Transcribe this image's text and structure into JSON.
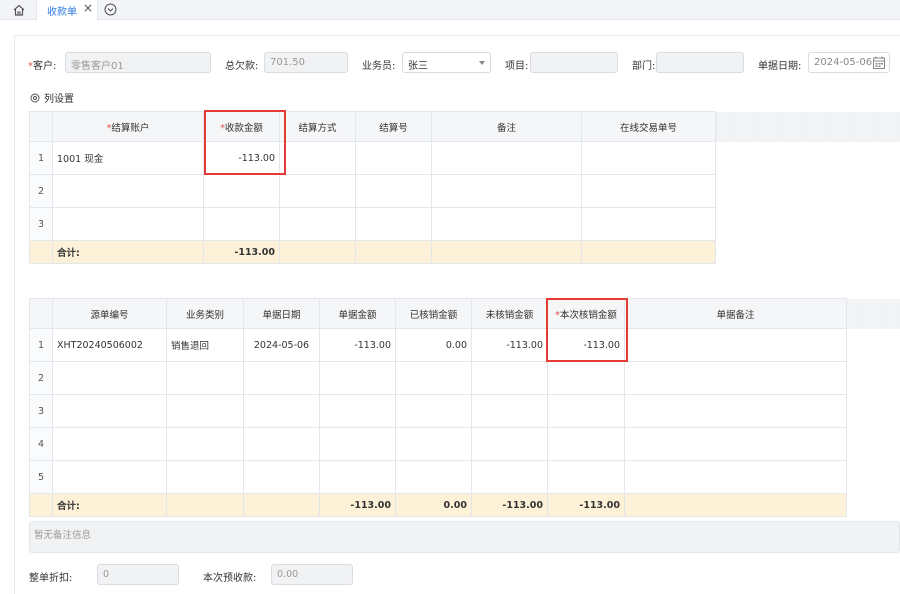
{
  "tabs": {
    "active_label": "收款单"
  },
  "form": {
    "customer": {
      "label": "客户:",
      "value": "零售客户01"
    },
    "total_due": {
      "label": "总欠款:",
      "value": "701.50"
    },
    "salesperson": {
      "label": "业务员:",
      "value": "张三"
    },
    "project": {
      "label": "项目:",
      "value": ""
    },
    "department": {
      "label": "部门:",
      "value": ""
    },
    "doc_date": {
      "label": "单据日期:",
      "value": "2024-05-06"
    }
  },
  "column_settings": "列设置",
  "receipt_grid": {
    "headers": [
      "结算账户",
      "收款金额",
      "结算方式",
      "结算号",
      "备注",
      "在线交易单号"
    ],
    "rows": [
      {
        "no": "1",
        "account": "1001 现金",
        "amount": "-113.00",
        "method": "",
        "settle_no": "",
        "remark": "",
        "online_no": ""
      },
      {
        "no": "2",
        "account": "",
        "amount": "",
        "method": "",
        "settle_no": "",
        "remark": "",
        "online_no": ""
      },
      {
        "no": "3",
        "account": "",
        "amount": "",
        "method": "",
        "settle_no": "",
        "remark": "",
        "online_no": ""
      }
    ],
    "total_label": "合计:",
    "total_amount": "-113.00"
  },
  "source_grid": {
    "headers": [
      "源单编号",
      "业务类别",
      "单据日期",
      "单据金额",
      "已核销金额",
      "未核销金额",
      "本次核销金额",
      "单据备注"
    ],
    "rows": [
      {
        "no": "1",
        "src_no": "XHT20240506002",
        "biz_type": "销售退回",
        "date": "2024-05-06",
        "amount": "-113.00",
        "written_off": "0.00",
        "unwritten": "-113.00",
        "this_writeoff": "-113.00",
        "remark": ""
      },
      {
        "no": "2",
        "src_no": "",
        "biz_type": "",
        "date": "",
        "amount": "",
        "written_off": "",
        "unwritten": "",
        "this_writeoff": "",
        "remark": ""
      },
      {
        "no": "3",
        "src_no": "",
        "biz_type": "",
        "date": "",
        "amount": "",
        "written_off": "",
        "unwritten": "",
        "this_writeoff": "",
        "remark": ""
      },
      {
        "no": "4",
        "src_no": "",
        "biz_type": "",
        "date": "",
        "amount": "",
        "written_off": "",
        "unwritten": "",
        "this_writeoff": "",
        "remark": ""
      },
      {
        "no": "5",
        "src_no": "",
        "biz_type": "",
        "date": "",
        "amount": "",
        "written_off": "",
        "unwritten": "",
        "this_writeoff": "",
        "remark": ""
      }
    ],
    "total_label": "合计:",
    "totals": {
      "amount": "-113.00",
      "written_off": "0.00",
      "unwritten": "-113.00",
      "this_writeoff": "-113.00"
    }
  },
  "remark_placeholder": "暂无备注信息",
  "discount": {
    "label": "整单折扣:",
    "value": "0"
  },
  "prepay": {
    "label": "本次预收款:",
    "value": "0.00"
  },
  "colors": {
    "accent": "#2d7be5",
    "required": "#e24b4b",
    "highlight": "#e53935",
    "total_row": "#fdf1d8"
  }
}
